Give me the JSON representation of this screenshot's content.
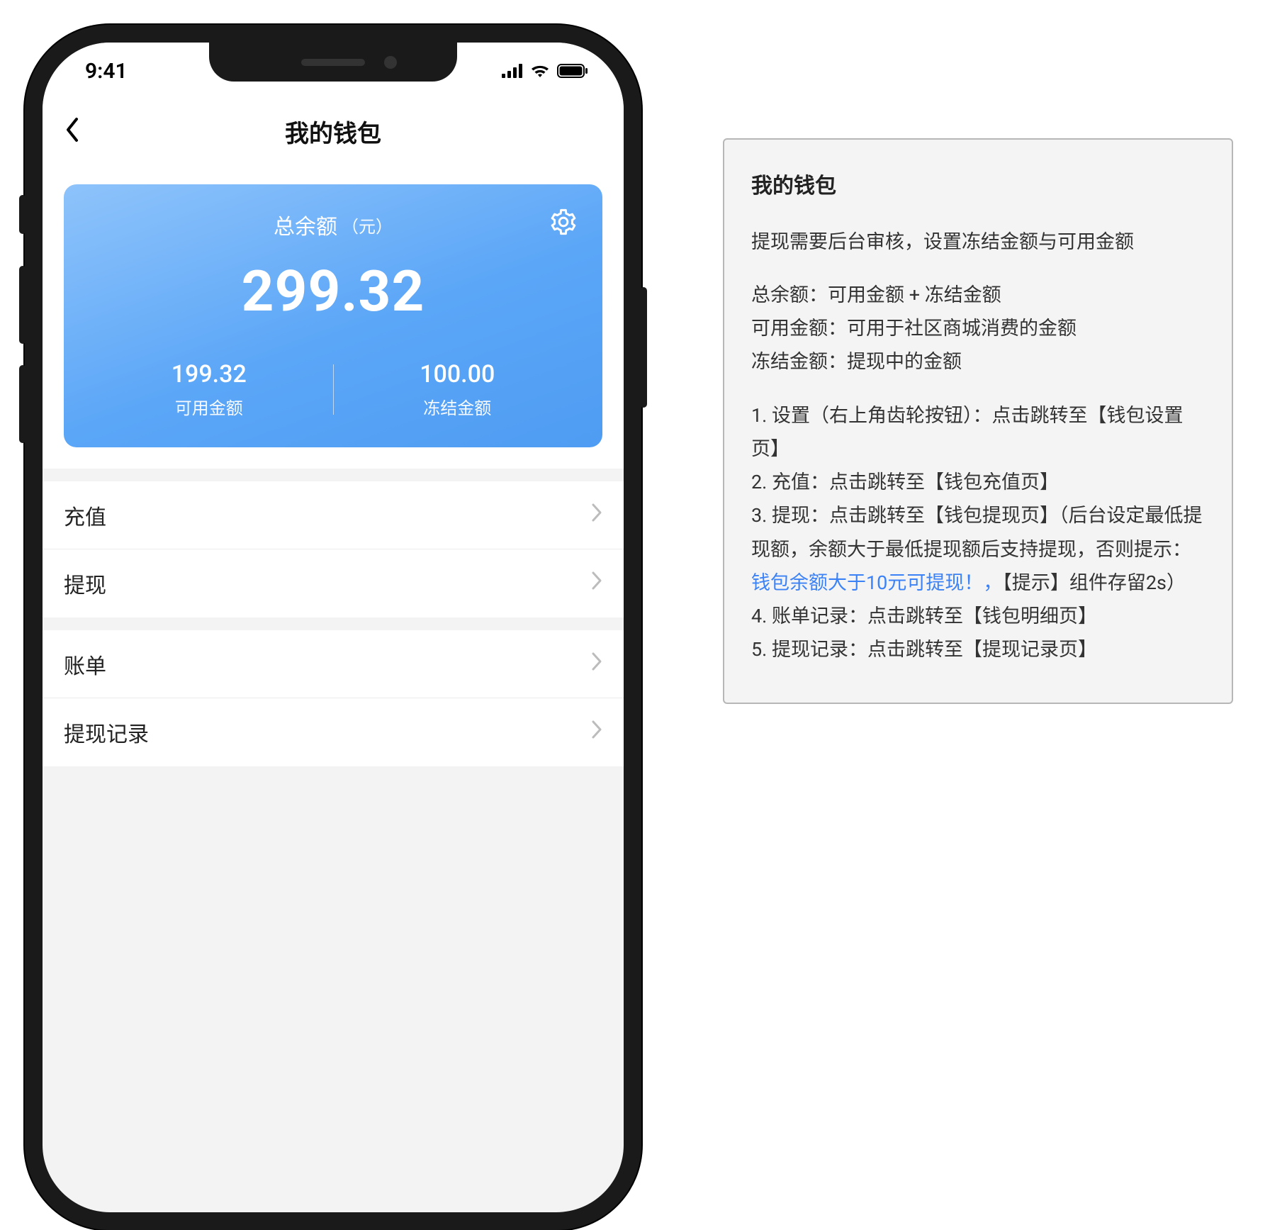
{
  "statusbar": {
    "time": "9:41"
  },
  "navbar": {
    "title": "我的钱包"
  },
  "balance": {
    "title": "总余额",
    "unit": "（元）",
    "total": "299.32",
    "available_value": "199.32",
    "available_label": "可用金额",
    "frozen_value": "100.00",
    "frozen_label": "冻结金额"
  },
  "menu_group1": [
    {
      "label": "充值"
    },
    {
      "label": "提现"
    }
  ],
  "menu_group2": [
    {
      "label": "账单"
    },
    {
      "label": "提现记录"
    }
  ],
  "annotation": {
    "title": "我的钱包",
    "intro": "提现需要后台审核，设置冻结金额与可用金额",
    "defs": [
      "总余额：可用金额 + 冻结金额",
      "可用金额：可用于社区商城消费的金额",
      "冻结金额：提现中的金额"
    ],
    "items": {
      "l1": "1. 设置（右上角齿轮按钮）：点击跳转至【钱包设置页】",
      "l2": "2. 充值：点击跳转至【钱包充值页】",
      "l3a": "3. 提现：点击跳转至【钱包提现页】（后台设定最低提现额，余额大于最低提现额后支持提现，否则提示：",
      "l3link": "钱包余额大于10元可提现！，",
      "l3b": "【提示】组件存留2s）",
      "l4": "4. 账单记录：点击跳转至【钱包明细页】",
      "l5": "5. 提现记录：点击跳转至【提现记录页】"
    }
  }
}
